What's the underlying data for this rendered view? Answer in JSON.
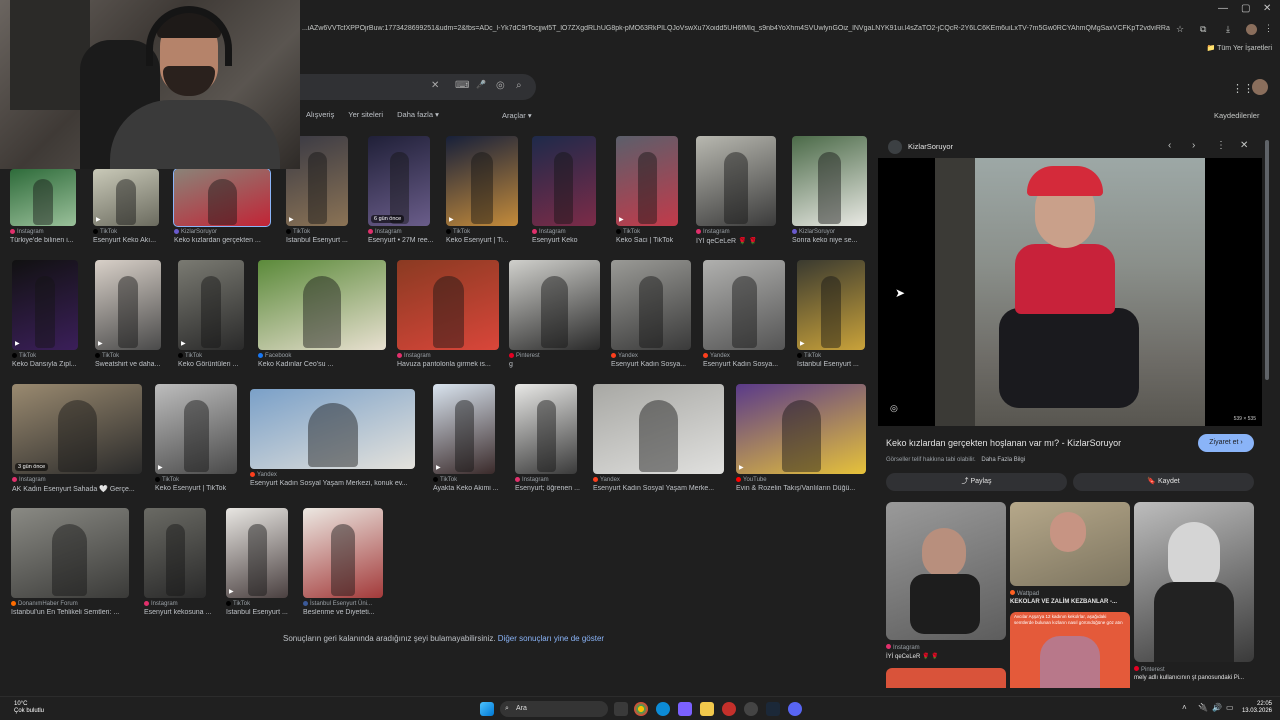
{
  "browser": {
    "url": "...iAZw6VVTcfXPPOjrBuw:1773428699251&udm=2&fbs=ADc_l-Yk7dC9rTocjjwl5T_lO7ZXgdRLhUG8pk-pMO63RkPILQJoVswXu7Xoidd5UH6fMIq_s9nb4YoXhm4SVUwlynGOiz_lNVgaLNYK91ui.l4sZaTO2-jCQcR-2Y6LC6KEm6uiLxTV-7m5Gw0RCYAhmQMgSaxVCFKpT2vdviRRagKUu_1hVqR...",
    "bookmarks_folder": "Tüm Yer İşaretleri",
    "window_controls": [
      "—",
      "▢",
      "✕"
    ]
  },
  "search": {
    "clear": "✕",
    "keyboard": "⌨",
    "mic": "🎤",
    "lens": "◎",
    "search": "⌕"
  },
  "filters": [
    "Alışveriş",
    "Yer siteleri",
    "Daha fazla ▾"
  ],
  "tools_label": "Araçlar ▾",
  "saved_label": "Kaydedilenler",
  "grid": [
    {
      "id": "r1a",
      "src": "Instagram",
      "title": "Türkiye'de bilinen i...",
      "color": "#e1306c"
    },
    {
      "id": "r1b",
      "src": "TikTok",
      "title": "Esenyurt Keko Akı...",
      "color": "#000"
    },
    {
      "id": "r1c",
      "src": "KizlarSoruyor",
      "title": "Keko kızlardan gerçekten ...",
      "color": "#6a5acd"
    },
    {
      "id": "r1d",
      "src": "TikTok",
      "title": "İstanbul Esenyurt ...",
      "color": "#000"
    },
    {
      "id": "r1e",
      "src": "Instagram",
      "title": "Esenyurt • 27M ree...",
      "color": "#e1306c",
      "badge": "6 gün önce"
    },
    {
      "id": "r1f",
      "src": "TikTok",
      "title": "Keko Esenyurt | Ti...",
      "color": "#000"
    },
    {
      "id": "r1g",
      "src": "Instagram",
      "title": "Esenyurt Keko",
      "color": "#e1306c"
    },
    {
      "id": "r1h",
      "src": "TikTok",
      "title": "Keko Saci | TikTok",
      "color": "#000"
    },
    {
      "id": "r1i",
      "src": "Instagram",
      "title": "İYİ qeCeLeR 🌹 🌹",
      "color": "#e1306c"
    },
    {
      "id": "r1j",
      "src": "KizlarSoruyor",
      "title": "Sonra keko niye se...",
      "color": "#6a5acd"
    },
    {
      "id": "r2a",
      "src": "TikTok",
      "title": "Keko Dansıyla Zıpl...",
      "color": "#000"
    },
    {
      "id": "r2b",
      "src": "TikTok",
      "title": "Sweatshirt ve daha...",
      "color": "#000"
    },
    {
      "id": "r2c",
      "src": "TikTok",
      "title": "Keko Görüntüleri ...",
      "color": "#000"
    },
    {
      "id": "r2d",
      "src": "Facebook",
      "title": "Keko Kadınlar Ceo'su ...",
      "color": "#1877f2"
    },
    {
      "id": "r2e",
      "src": "Instagram",
      "title": "Havuza pantolonla girmek is...",
      "color": "#e1306c"
    },
    {
      "id": "r2f",
      "src": "Pinterest",
      "title": "g",
      "color": "#e60023"
    },
    {
      "id": "r2g",
      "src": "Yandex",
      "title": "Esenyurt Kadın Sosya...",
      "color": "#fc3f1d"
    },
    {
      "id": "r2h",
      "src": "Yandex",
      "title": "Esenyurt Kadın Sosya...",
      "color": "#fc3f1d"
    },
    {
      "id": "r2i",
      "src": "TikTok",
      "title": "İstanbul Esenyurt ...",
      "color": "#000"
    },
    {
      "id": "r3a",
      "src": "Instagram",
      "title": "AK Kadın Esenyurt Sahada 🤍 Gerçe...",
      "color": "#e1306c",
      "badge": "3 gün önce"
    },
    {
      "id": "r3b",
      "src": "TikTok",
      "title": "Keko Esenyurt | TikTok",
      "color": "#000"
    },
    {
      "id": "r3c",
      "src": "Yandex",
      "title": "Esenyurt Kadın Sosyal Yaşam Merkezi, konuk ev...",
      "color": "#fc3f1d"
    },
    {
      "id": "r3d",
      "src": "TikTok",
      "title": "Ayakta Keko Akimi ...",
      "color": "#000"
    },
    {
      "id": "r3e",
      "src": "Instagram",
      "title": "Esenyurt; öğrenen ...",
      "color": "#e1306c"
    },
    {
      "id": "r3f",
      "src": "Yandex",
      "title": "Esenyurt Kadın Sosyal Yaşam Merke...",
      "color": "#fc3f1d"
    },
    {
      "id": "r3g",
      "src": "YouTube",
      "title": "Evin & Rozelin Takış/Vanlıların Düğü...",
      "color": "#ff0000"
    },
    {
      "id": "r4a",
      "src": "DonanımHaber Forum",
      "title": "İstanbul'un En Tehlikeli Semtleri: ...",
      "color": "#ff6d00"
    },
    {
      "id": "r4b",
      "src": "Instagram",
      "title": "Esenyurt kekosuna ...",
      "color": "#e1306c"
    },
    {
      "id": "r4c",
      "src": "TikTok",
      "title": "İstanbul Esenyurt ...",
      "color": "#000"
    },
    {
      "id": "r4d",
      "src": "İstanbul Esenyurt Üni...",
      "title": "Beslenme ve Diyeteti...",
      "color": "#3b5998"
    }
  ],
  "endnote": {
    "text": "Sonuçların geri kalanında aradığınız şeyi bulamayabilirsiniz.",
    "link": "Diğer sonuçları yine de göster"
  },
  "panel": {
    "site": "KizlarSoruyor",
    "controls": [
      "‹",
      "›",
      "⋮",
      "✕"
    ],
    "dimensions": "539 × 535",
    "title": "Keko kızlardan gerçekten hoşlanan var mı? - KizlarSoruyor",
    "visit": "Ziyaret et ›",
    "notice": "Görseller telif hakkına tabi olabilir.",
    "notice_more": "Daha Fazla Bilgi",
    "share": "Paylaş",
    "save": "Kaydet",
    "related": [
      {
        "src": "Instagram",
        "title": "İYİ qeCeLeR 🌹 🌹",
        "color": "#e1306c"
      },
      {
        "src": "Wattpad",
        "title": "KEKOLAR VE ZALİM KEZBANLAR -...",
        "color": "#ff6122"
      },
      {
        "src": "Pinterest",
        "title": "mely adlı kullanıcının şt panosundaki Pi...",
        "color": "#e60023"
      }
    ],
    "red_strip_text": "Avcılar Aşşa'ya 12 kadının kekolrlar, aşağıdaki semtlerde bulunan kızların nasıl göründüğüne göz atın"
  },
  "taskbar": {
    "temp": "10°C",
    "weather": "Çok bulutlu",
    "search_label": "Ara",
    "time": "22:05",
    "date": "13.03.2026"
  }
}
